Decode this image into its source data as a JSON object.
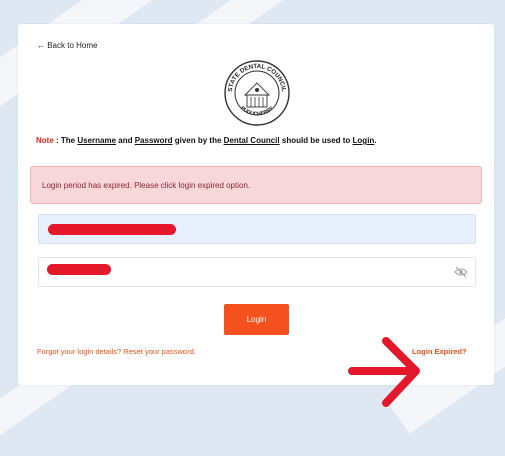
{
  "back_link": "← Back to Home",
  "note": {
    "prefix": "Note",
    "sep": " : The ",
    "username": "Username",
    "and": " and ",
    "password": "Password",
    "given": " given by the ",
    "council": "Dental Council",
    "should": " should be used to ",
    "login": "Login",
    "end": "."
  },
  "seal": {
    "top_text": "STATE DENTAL COUNCIL",
    "bottom_text": "PUDUCHERRY"
  },
  "alert": "Login period has expired. Please click login expired option.",
  "login_button": "Login",
  "forgot_link": "Forgot your login details? Reset your password.",
  "expired_link": "Login Expired?",
  "colors": {
    "accent": "#f4511e",
    "alert_bg": "#f8d7da",
    "redaction": "#e5182b"
  },
  "icons": {
    "password_toggle": "eye-slash-icon",
    "annotation": "red-arrow"
  }
}
